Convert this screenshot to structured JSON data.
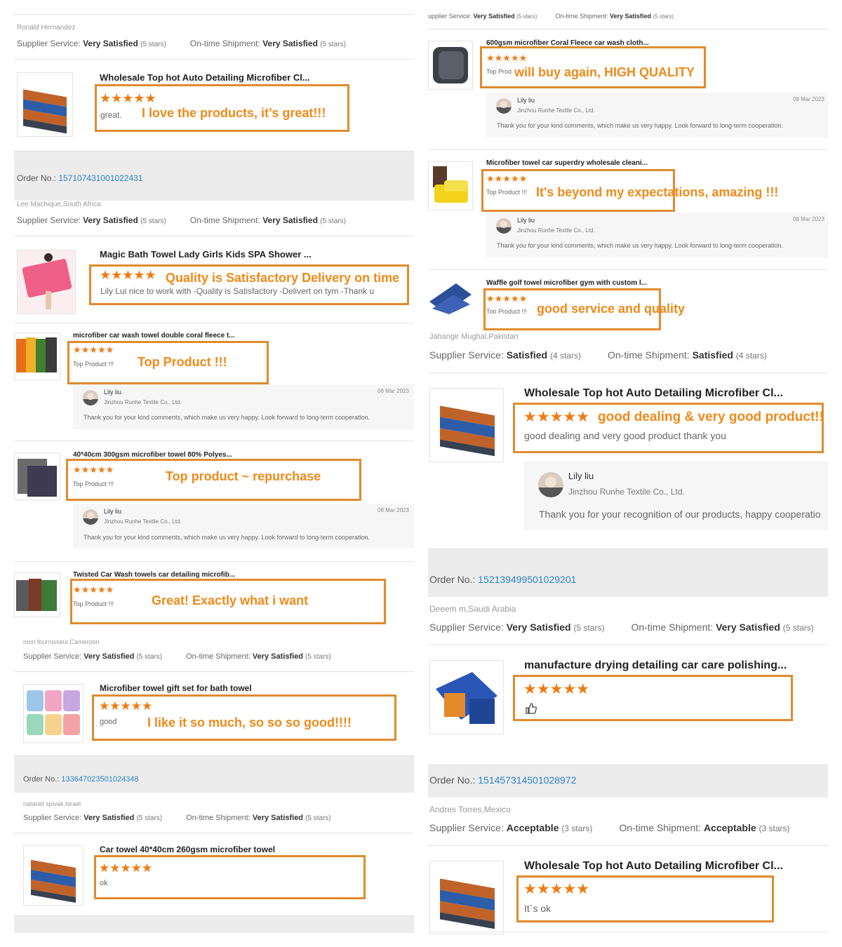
{
  "colors": {
    "accent": "#ef8a1a",
    "link": "#2a83c6",
    "star": "#f07a12",
    "box": "#e08b2e"
  },
  "icons": {
    "star": "★",
    "thumbs_up": "thumbs-up-icon"
  },
  "left": {
    "r1": {
      "buyer": "Ronald Hernandez",
      "svc_label": "Supplier Service:",
      "svc_val": "Very Satisfied",
      "svc_stars": "(5 stars)",
      "ship_label": "On-time Shipment:",
      "ship_val": "Very Satisfied",
      "ship_stars": "(5 stars)",
      "title": "Wholesale Top hot Auto Detailing Microfiber Cl...",
      "stars": "★★★★★",
      "comment": "great.",
      "callout": "I love the products, it’s great!!!"
    },
    "r2": {
      "order_label": "Order No.:",
      "order_num": "157107431001022431",
      "buyer": "Lee Machique,South Africa",
      "svc_label": "Supplier Service:",
      "svc_val": "Very Satisfied",
      "svc_stars": "(5 stars)",
      "ship_label": "On-time Shipment:",
      "ship_val": "Very Satisfied",
      "ship_stars": "(5 stars)",
      "title": "Magic Bath Towel Lady Girls Kids SPA Shower ...",
      "stars": "★★★★★",
      "callout": "Quality is Satisfactory Delivery on time",
      "comment": "Lily Lui  nice to work with -Quality is Satisfactory -Delivert on tym -Thank u"
    },
    "r3": {
      "title": "microfiber car wash towel double coral fleece t...",
      "stars": "★★★★★",
      "top": "Top Product !!!",
      "callout": "Top Product !!!",
      "reply_name": "Lily liu",
      "reply_company": "Jinzhou Runhe Textile Co., Ltd.",
      "reply_date": "08 Mar 2023",
      "reply_text": "Thank you for your kind comments, which make us very happy. Look forward to long-term cooperation."
    },
    "r4": {
      "title": "40*40cm 300gsm microfiber towel 80% Polyes...",
      "stars": "★★★★★",
      "top": "Top Product !!!",
      "callout": "Top  product ~ repurchase",
      "reply_name": "Lily liu",
      "reply_company": "Jinzhou Runhe Textile Co., Ltd.",
      "reply_date": "08 Mar 2023",
      "reply_text": "Thank you for your kind comments, which make us very happy. Look forward to long-term cooperation."
    },
    "r5": {
      "title": "Twisted Car Wash towels car detailing microfib...",
      "stars": "★★★★★",
      "top": "Top Product !!!",
      "callout": "Great! Exactly what i want"
    },
    "r6": {
      "buyer": "mon fournisseur,Cameroon",
      "svc_label": "Supplier Service:",
      "svc_val": "Very Satisfied",
      "svc_stars": "(5 stars)",
      "ship_label": "On-time Shipment:",
      "ship_val": "Very Satisfied",
      "ship_stars": "(5 stars)",
      "title": "Microfiber towel gift set for bath towel",
      "stars": "★★★★★",
      "comment": "good",
      "callout": "I like it so much, so so so good!!!!"
    },
    "r7": {
      "order_label": "Order No.:",
      "order_num": "133647023501024348",
      "buyer": "natanel spivak,Israel",
      "svc_label": "Supplier Service:",
      "svc_val": "Very Satisfied",
      "svc_stars": "(5 stars)",
      "ship_label": "On-time Shipment:",
      "ship_val": "Very Satisfied",
      "ship_stars": "(5 stars)",
      "title": "Car towel 40*40cm 260gsm microfiber towel",
      "stars": "★★★★★",
      "comment": "ok"
    }
  },
  "right": {
    "h0": {
      "svc_label": "upplier Service:",
      "svc_val": "Very Satisfied",
      "svc_stars": "(5 stars)",
      "ship_label": "On-time Shipment:",
      "ship_val": "Very Satisfied",
      "ship_stars": "(5 stars)"
    },
    "r1": {
      "title": "600gsm microfiber Coral Fleece car wash cloth...",
      "stars": "★★★★★",
      "top": "Top Prod",
      "callout": "will buy again, HIGH QUALITY",
      "reply_name": "Lily liu",
      "reply_company": "Jinzhou Runhe Textile Co., Ltd.",
      "reply_date": "08 Mar 2023",
      "reply_text": "Thank you for your kind comments, which make us very happy. Look forward to long-term cooperation."
    },
    "r2": {
      "title": "Microfiber towel car superdry wholesale cleani...",
      "stars": "★★★★★",
      "top": "Top Product !!!",
      "callout": "It's beyond my expectations, amazing !!!",
      "reply_name": "Lily liu",
      "reply_company": "Jinzhou Runhe Textile Co., Ltd.",
      "reply_date": "08 Mar 2023",
      "reply_text": "Thank you for your kind comments, which make us very happy. Look forward to long-term cooperation."
    },
    "r3": {
      "title": "Waffle golf towel microfiber gym with custom l...",
      "stars": "★★★★★",
      "top": "Top Product !!!",
      "callout": "good service and quality"
    },
    "r4": {
      "buyer": "Jahangir Mughal,Pakistan",
      "svc_label": "Supplier Service:",
      "svc_val": "Satisfied",
      "svc_stars": "(4 stars)",
      "ship_label": "On-time Shipment:",
      "ship_val": "Satisfied",
      "ship_stars": "(4 stars)",
      "title": "Wholesale Top hot Auto Detailing Microfiber Cl...",
      "stars": "★★★★★",
      "callout": "good dealing & very good product!!",
      "comment": "good dealing and very good product thank you",
      "reply_name": "Lily liu",
      "reply_company": "Jinzhou Runhe Textile Co., Ltd.",
      "reply_text": "Thank you for your recognition of our products, happy cooperatio"
    },
    "r5": {
      "order_label": "Order No.:",
      "order_num": "152139499501029201",
      "buyer": "Deeem m,Saudi Arabia",
      "svc_label": "Supplier Service:",
      "svc_val": "Very Satisfied",
      "svc_stars": "(5 stars)",
      "ship_label": "On-time Shipment:",
      "ship_val": "Very Satisfied",
      "ship_stars": "(5 stars)",
      "title": "manufacture drying detailing car care polishing...",
      "stars": "★★★★★"
    },
    "r6": {
      "order_label": "Order No.:",
      "order_num": "151457314501028972",
      "buyer": "Andres Torres,Mexico",
      "svc_label": "Supplier Service:",
      "svc_val": "Acceptable",
      "svc_stars": "(3 stars)",
      "ship_label": "On-time Shipment:",
      "ship_val": "Acceptable",
      "ship_stars": "(3 stars)",
      "title": "Wholesale Top hot Auto Detailing Microfiber Cl...",
      "stars": "★★★★★",
      "comment": "It`s ok"
    }
  }
}
